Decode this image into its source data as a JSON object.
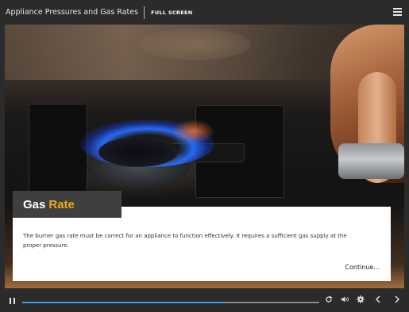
{
  "header": {
    "title": "Appliance Pressures and Gas Rates",
    "fullscreen_label": "FULL SCREEN",
    "menu_icon": "hamburger-menu-icon"
  },
  "slide": {
    "heading_part1": "Gas",
    "heading_part2": "Rate",
    "body": "The burner gas rate must be correct for an appliance to function effectively. It requires a sufficient gas supply at the proper pressure.",
    "continue_label": "Continue...",
    "accent_color": "#f7a61e",
    "background_image": "gas-stove-burner-flame-photo"
  },
  "player": {
    "progress": 0.68,
    "progress_color": "#4a9be0",
    "icons": [
      "pause-icon",
      "replay-icon",
      "volume-icon",
      "settings-icon",
      "previous-icon",
      "next-icon"
    ]
  }
}
